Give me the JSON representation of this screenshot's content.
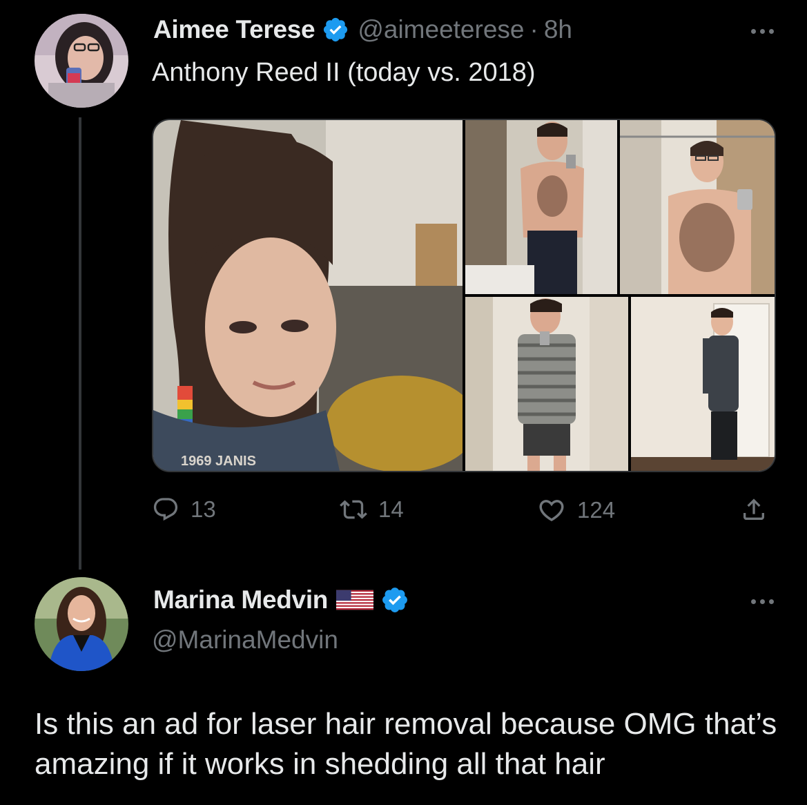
{
  "tweet": {
    "author": {
      "display_name": "Aimee Terese",
      "handle": "@aimeeterese",
      "verified": true,
      "avatar_icon": "user-avatar"
    },
    "separator": "·",
    "time": "8h",
    "text": "Anthony Reed II (today vs. 2018)",
    "media": [
      {
        "icon": "photo-selfie-rainbow-earring"
      },
      {
        "icon": "photo-mirror-selfie-shirtless"
      },
      {
        "icon": "photo-bathroom-selfie-shirtless"
      },
      {
        "icon": "photo-mirror-selfie-striped-shirt"
      },
      {
        "icon": "photo-standing-dress-shirt"
      }
    ],
    "actions": {
      "replies": "13",
      "reposts": "14",
      "likes": "124"
    }
  },
  "reply": {
    "author": {
      "display_name": "Marina Medvin",
      "flag": "🇺🇸",
      "handle": "@MarinaMedvin",
      "verified": true,
      "avatar_icon": "user-avatar"
    },
    "text": "Is this an ad for laser hair removal because OMG that’s amazing if it works in shedding all that hair"
  },
  "colors": {
    "background": "#000000",
    "text_primary": "#e7e9ea",
    "text_secondary": "#71767b",
    "verified_blue": "#1d9bf0",
    "thread_line": "#333639"
  }
}
